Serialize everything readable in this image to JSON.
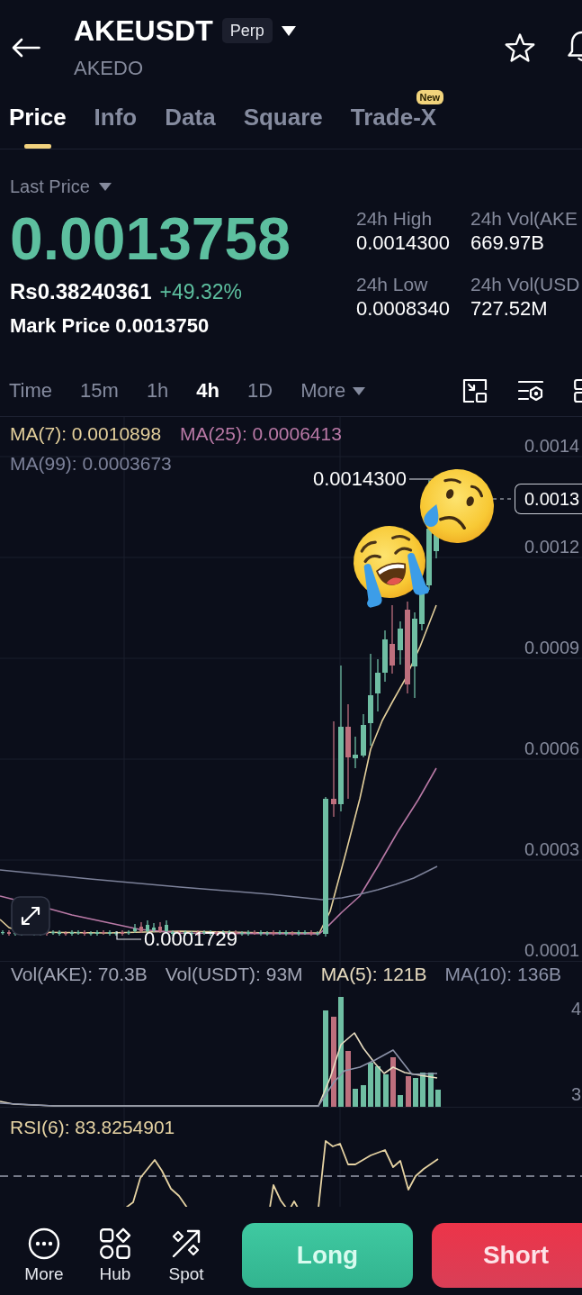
{
  "header": {
    "symbol": "AKEUSDT",
    "contract_type": "Perp",
    "name": "AKEDO"
  },
  "tabs": [
    {
      "label": "Price",
      "selected": true
    },
    {
      "label": "Info",
      "selected": false
    },
    {
      "label": "Data",
      "selected": false
    },
    {
      "label": "Square",
      "selected": false
    },
    {
      "label": "Trade-X",
      "selected": false,
      "badge": "New"
    }
  ],
  "price_panel": {
    "price_type": "Last Price",
    "last_price": "0.0013758",
    "converted_price": "Rs0.38240361",
    "change": "+49.32%",
    "mark_price_label": "Mark Price",
    "mark_price": "0.0013750",
    "stats": [
      {
        "label": "24h High",
        "value": "0.0014300"
      },
      {
        "label": "24h Vol(AKE",
        "value": "669.97B"
      },
      {
        "label": "24h Low",
        "value": "0.0008340"
      },
      {
        "label": "24h Vol(USD",
        "value": "727.52M"
      }
    ]
  },
  "intervals": [
    {
      "label": "Time",
      "kind": "option",
      "selected": false
    },
    {
      "label": "15m",
      "kind": "option",
      "selected": false
    },
    {
      "label": "1h",
      "kind": "option",
      "selected": false
    },
    {
      "label": "4h",
      "kind": "option",
      "selected": true
    },
    {
      "label": "1D",
      "kind": "option",
      "selected": false
    },
    {
      "label": "More",
      "kind": "menu",
      "selected": false
    }
  ],
  "chart": {
    "indicators": [
      {
        "label": "MA(7): 0.0010898",
        "color": "#e3cf9b"
      },
      {
        "label": "MA(25): 0.0006413",
        "color": "#b979a6"
      },
      {
        "label": "MA(99): 0.0003673",
        "color": "#7c8199"
      }
    ],
    "price_axis": [
      "0.0014",
      "0.0012",
      "0.0009",
      "0.0006",
      "0.0003",
      "0.0001"
    ],
    "current_price_tag": "0.0013",
    "high_marker": "0.0014300",
    "low_marker": "0.0001729"
  },
  "volume": {
    "indicators": [
      {
        "label": "Vol(AKE): 70.3B",
        "color": "#a2a6b6"
      },
      {
        "label": "Vol(USDT): 93M",
        "color": "#a2a6b6"
      },
      {
        "label": "MA(5): 121B",
        "color": "#e8dcc0"
      },
      {
        "label": "MA(10): 136B",
        "color": "#8c92a8"
      }
    ],
    "axis": [
      "4",
      "3"
    ]
  },
  "rsi": {
    "label": "RSI(6): 83.8254901"
  },
  "bottom_bar": {
    "shortcuts": [
      {
        "label": "More"
      },
      {
        "label": "Hub"
      },
      {
        "label": "Spot"
      }
    ],
    "actions": [
      {
        "label": "Long",
        "kind": "long"
      },
      {
        "label": "Short",
        "kind": "short"
      }
    ]
  }
}
